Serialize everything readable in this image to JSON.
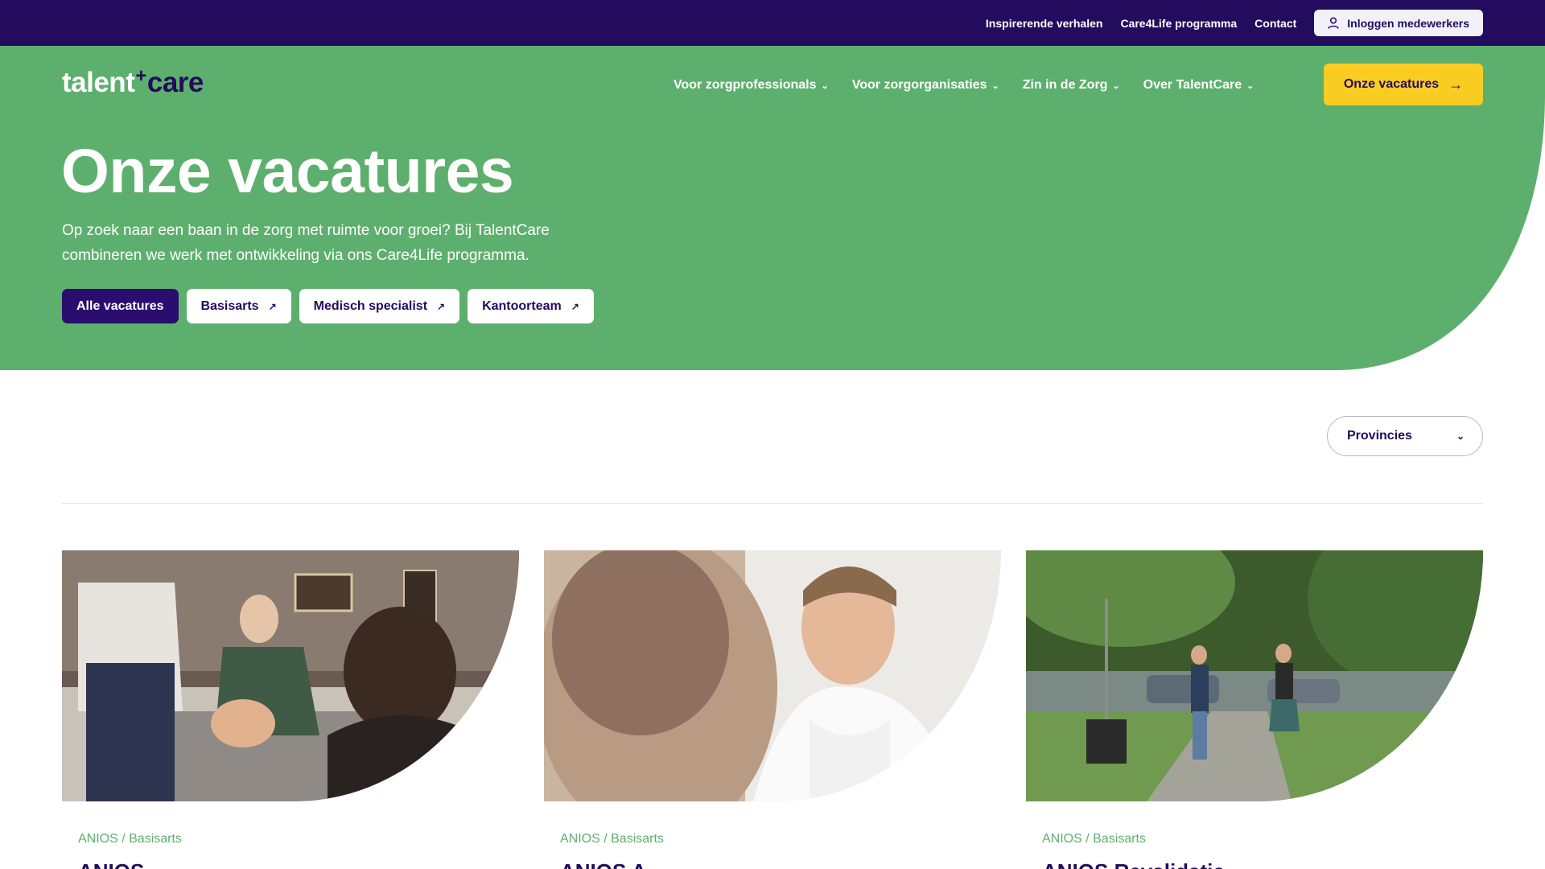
{
  "topbar": {
    "links": [
      "Inspirerende verhalen",
      "Care4Life programma",
      "Contact"
    ],
    "login_label": "Inloggen medewerkers",
    "login_icon": "user-icon"
  },
  "logo": {
    "part1": "talent",
    "plus": "+",
    "part2": "care"
  },
  "nav": {
    "items": [
      "Voor zorgprofessionals",
      "Voor zorgorganisaties",
      "Zin in de Zorg",
      "Over TalentCare"
    ],
    "cta_label": "Onze vacatures"
  },
  "hero": {
    "title": "Onze vacatures",
    "description": "Op zoek naar een baan in de zorg met ruimte voor groei? Bij TalentCare combineren we werk met ontwikkeling via ons Care4Life programma.",
    "filters": [
      "Alle vacatures",
      "Basisarts",
      "Medisch specialist",
      "Kantoorteam"
    ],
    "active_filter": "Alle vacatures"
  },
  "provinces": {
    "label": "Provincies"
  },
  "cards": [
    {
      "tag": "ANIOS / Basisarts",
      "title": "ANIOS",
      "image": "doctor-examining-elderly-patient"
    },
    {
      "tag": "ANIOS / Basisarts",
      "title": "ANIOS A",
      "image": "smiling-doctor-portrait"
    },
    {
      "tag": "ANIOS / Basisarts",
      "title": "ANIOS Revalidatie",
      "image": "two-women-walking-in-park"
    }
  ],
  "colors": {
    "navy": "#230b5e",
    "green": "#5daf6d",
    "yellow": "#f9cc22"
  }
}
